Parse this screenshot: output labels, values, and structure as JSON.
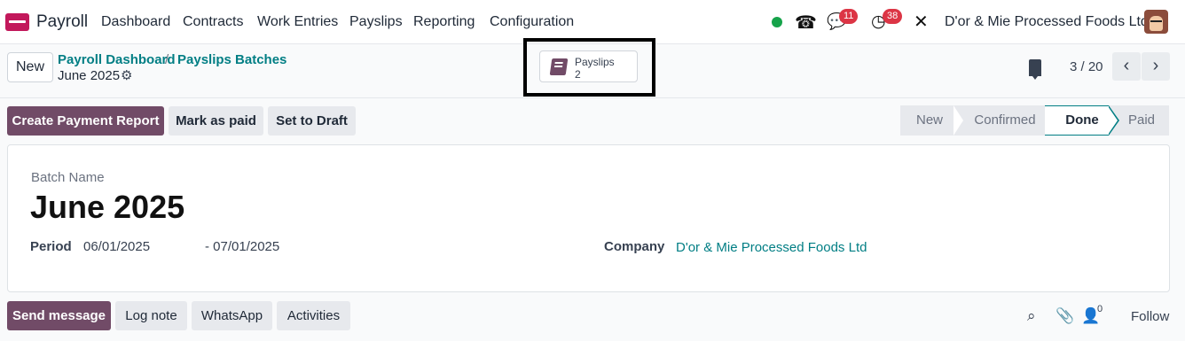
{
  "nav": {
    "app_name": "Payroll",
    "menu": [
      "Dashboard",
      "Contracts",
      "Work Entries",
      "Payslips",
      "Reporting",
      "Configuration"
    ],
    "messages_count": "11",
    "activities_count": "38",
    "company": "D'or & Mie Processed Foods Ltd"
  },
  "control": {
    "new_label": "New",
    "breadcrumb": [
      "Payroll Dashboard",
      "Payslips Batches"
    ],
    "breadcrumb_sep": "/",
    "record_title": "June 2025",
    "smart_button": {
      "label": "Payslips",
      "value": "2"
    },
    "pager": "3 / 20"
  },
  "actions": {
    "create_payment_report": "Create Payment Report",
    "mark_as_paid": "Mark as paid",
    "set_to_draft": "Set to Draft"
  },
  "stages": [
    {
      "label": "New",
      "active": false
    },
    {
      "label": "Confirmed",
      "active": false
    },
    {
      "label": "Done",
      "active": true
    },
    {
      "label": "Paid",
      "active": false
    }
  ],
  "form": {
    "batch_name_label": "Batch Name",
    "batch_name": "June 2025",
    "period_label": "Period",
    "period_start": "06/01/2025",
    "period_end": "- 07/01/2025",
    "company_label": "Company",
    "company_value": "D'or & Mie Processed Foods Ltd"
  },
  "chatter": {
    "send_message": "Send message",
    "log_note": "Log note",
    "whatsapp": "WhatsApp",
    "activities": "Activities",
    "followers_count": "0",
    "follow": "Follow"
  },
  "colors": {
    "brand": "#714b67",
    "link": "#017e84",
    "badge": "#dc3545",
    "online": "#16a34a"
  }
}
